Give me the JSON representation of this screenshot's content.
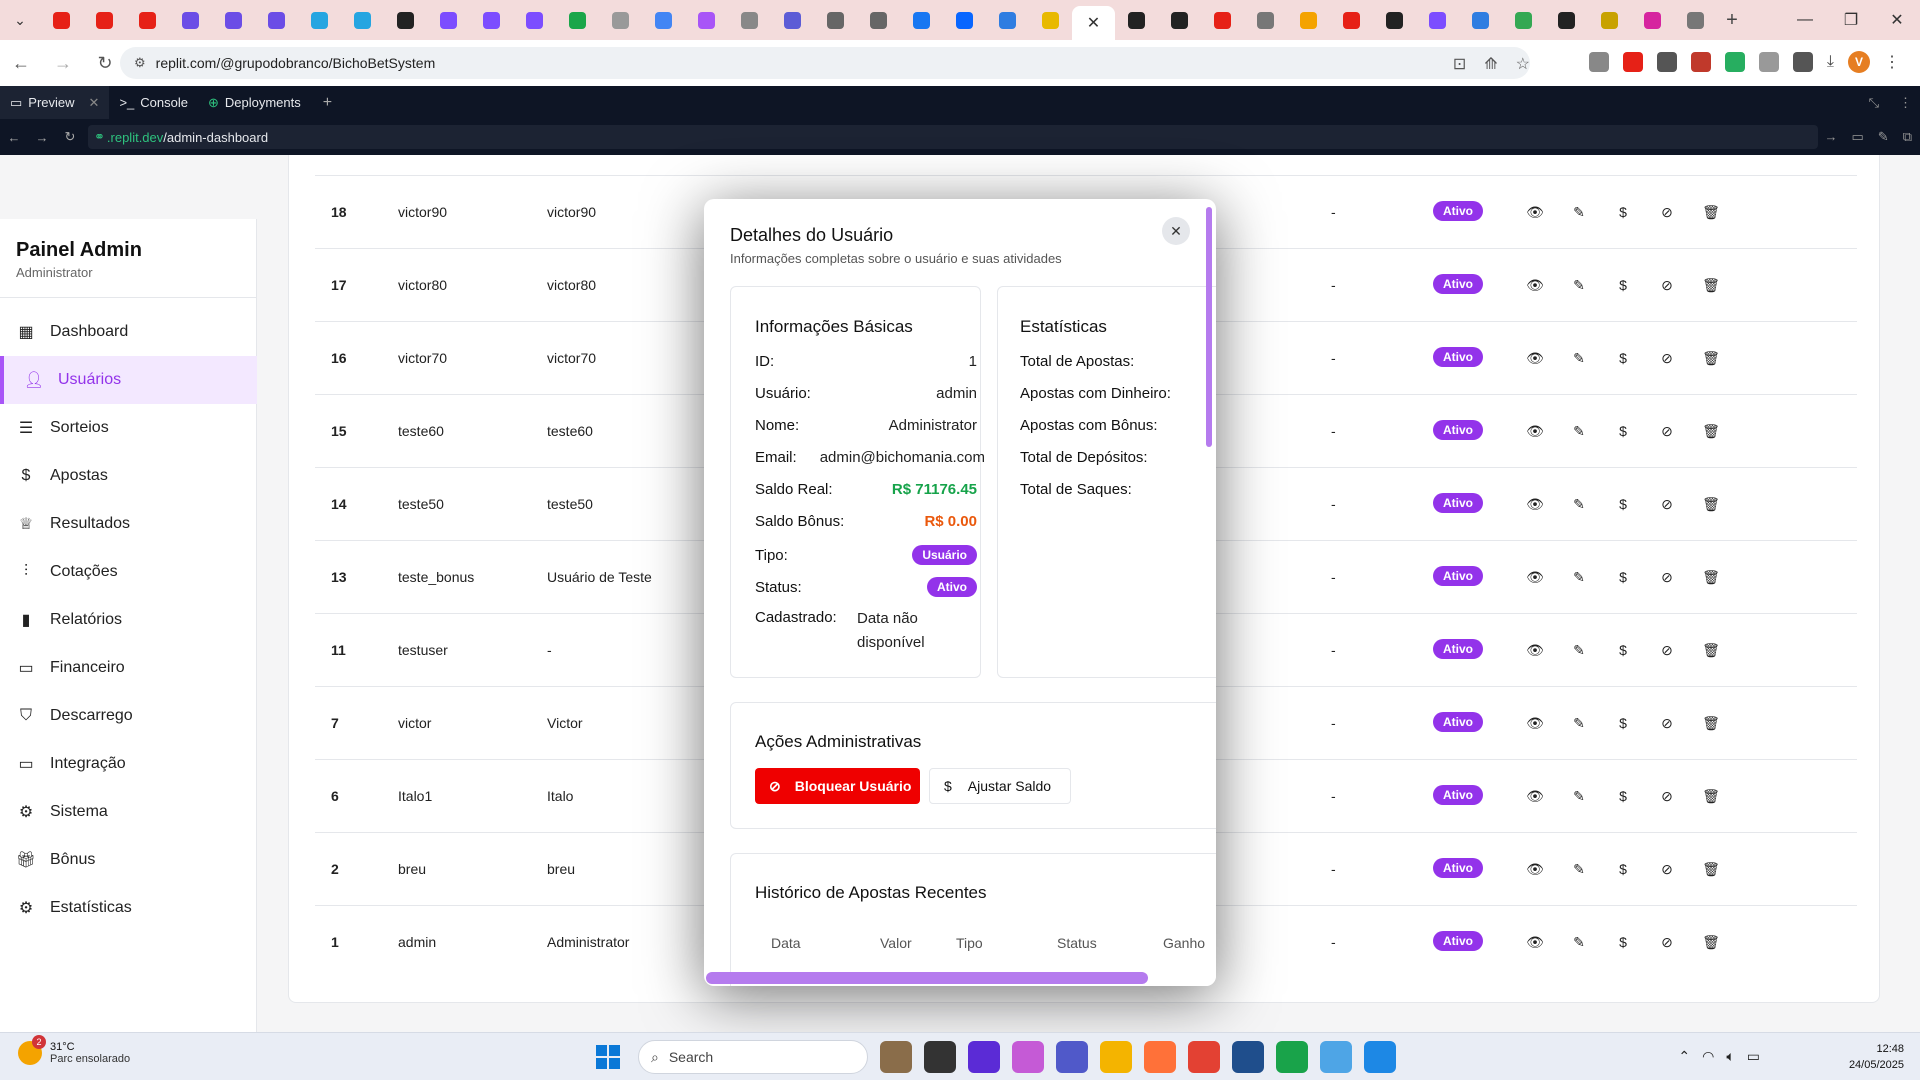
{
  "browser": {
    "tab_favicon_colors": [
      "#e62117",
      "#e62117",
      "#e62117",
      "#6b4de6",
      "#6b4de6",
      "#6b4de6",
      "#25a5e1",
      "#25a5e1",
      "#222222",
      "#7c4dff",
      "#7c4dff",
      "#7c4dff",
      "#1aa64a",
      "#999999",
      "#4285f4",
      "#a855f7",
      "#888888",
      "#5c5cd6",
      "#666666",
      "#666666",
      "#1877f2",
      "#0866ff",
      "#2f7de1",
      "#e8b900"
    ],
    "tab_favicon_colors_after": [
      "#222222",
      "#222222",
      "#e62117",
      "#777777",
      "#f4a300",
      "#e62117",
      "#222222",
      "#7c4dff",
      "#2f7de1",
      "#34a853",
      "#222222",
      "#c8a200",
      "#d6249f",
      "#777777"
    ],
    "active_tab_close": "✕",
    "url": "replit.com/@grupodobranco/BichoBetSystem",
    "ext_colors": [
      "#888888",
      "#e62117",
      "#555555",
      "#c0392b",
      "#27ae60",
      "#999999",
      "#555555"
    ],
    "profile_initial": "V"
  },
  "replit": {
    "tabs": [
      {
        "label": "Preview",
        "icon": "preview-icon"
      },
      {
        "label": "Console",
        "icon": "console-icon"
      },
      {
        "label": "Deployments",
        "icon": "deployments-icon"
      }
    ],
    "url_domain": ".replit.dev",
    "url_path": "/admin-dashboard"
  },
  "sidebar": {
    "title": "Painel Admin",
    "subtitle": "Administrator",
    "items": [
      {
        "label": "Dashboard",
        "icon": "dashboard-icon"
      },
      {
        "label": "Usuários",
        "icon": "users-icon",
        "active": true
      },
      {
        "label": "Sorteios",
        "icon": "list-icon"
      },
      {
        "label": "Apostas",
        "icon": "dollar-icon"
      },
      {
        "label": "Resultados",
        "icon": "trophy-icon"
      },
      {
        "label": "Cotações",
        "icon": "sliders-icon"
      },
      {
        "label": "Relatórios",
        "icon": "bar-chart-icon"
      },
      {
        "label": "Financeiro",
        "icon": "credit-card-icon"
      },
      {
        "label": "Descarrego",
        "icon": "shield-icon"
      },
      {
        "label": "Integração",
        "icon": "credit-card-icon"
      },
      {
        "label": "Sistema",
        "icon": "gear-icon"
      },
      {
        "label": "Bônus",
        "icon": "gift-icon"
      },
      {
        "label": "Estatísticas",
        "icon": "gear-icon"
      }
    ]
  },
  "users_table": {
    "rows": [
      {
        "id": "18",
        "username": "victor90",
        "name": "victor90",
        "col": "-",
        "status": "Ativo"
      },
      {
        "id": "17",
        "username": "victor80",
        "name": "victor80",
        "col": "-",
        "status": "Ativo"
      },
      {
        "id": "16",
        "username": "victor70",
        "name": "victor70",
        "col": "-",
        "status": "Ativo"
      },
      {
        "id": "15",
        "username": "teste60",
        "name": "teste60",
        "col": "-",
        "status": "Ativo"
      },
      {
        "id": "14",
        "username": "teste50",
        "name": "teste50",
        "col": "-",
        "status": "Ativo"
      },
      {
        "id": "13",
        "username": "teste_bonus",
        "name": "Usuário de Teste",
        "col": "-",
        "status": "Ativo"
      },
      {
        "id": "11",
        "username": "testuser",
        "name": "-",
        "col": "-",
        "status": "Ativo"
      },
      {
        "id": "7",
        "username": "victor",
        "name": "Victor",
        "col": "-",
        "status": "Ativo"
      },
      {
        "id": "6",
        "username": "Italo1",
        "name": "Italo",
        "col": "-",
        "status": "Ativo"
      },
      {
        "id": "2",
        "username": "breu",
        "name": "breu",
        "col": "-",
        "status": "Ativo"
      },
      {
        "id": "1",
        "username": "admin",
        "name": "Administrator",
        "col": "-",
        "status": "Ativo"
      }
    ],
    "row_actions": [
      "eye-icon",
      "edit-icon",
      "dollar-icon",
      "block-icon",
      "trash-icon"
    ]
  },
  "modal": {
    "title": "Detalhes do Usuário",
    "subtitle": "Informações completas sobre o usuário e suas atividades",
    "close": "✕",
    "basic": {
      "heading": "Informações Básicas",
      "id_label": "ID:",
      "id_value": "1",
      "user_label": "Usuário:",
      "user_value": "admin",
      "name_label": "Nome:",
      "name_value": "Administrator",
      "email_label": "Email:",
      "email_value": "admin@bichomania.com",
      "real_label": "Saldo Real:",
      "real_value": "R$ 71176.45",
      "bonus_label": "Saldo Bônus:",
      "bonus_value": "R$ 0.00",
      "type_label": "Tipo:",
      "type_value": "Usuário",
      "status_label": "Status:",
      "status_value": "Ativo",
      "registered_label": "Cadastrado:",
      "registered_value": "Data não disponível"
    },
    "stats": {
      "heading": "Estatísticas",
      "items": [
        "Total de Apostas:",
        "Apostas com Dinheiro:",
        "Apostas com Bônus:",
        "Total de Depósitos:",
        "Total de Saques:"
      ]
    },
    "admin_actions": {
      "heading": "Ações Administrativas",
      "block_label": "Bloquear Usuário",
      "adjust_label": "Ajustar Saldo"
    },
    "history": {
      "heading": "Histórico de Apostas Recentes",
      "columns": [
        "Data",
        "Valor",
        "Tipo",
        "Status",
        "Ganho"
      ]
    }
  },
  "taskbar": {
    "temperature": "31°C",
    "weather": "Parc ensolarado",
    "weather_badge": "2",
    "search_placeholder": "Search",
    "time": "12:48",
    "date": "24/05/2025",
    "app_colors": [
      "#8a6d4a",
      "#333333",
      "#5b2bd6",
      "#c55ad6",
      "#5059c9",
      "#f4b400",
      "#ff7139",
      "#e34133",
      "#1f4e8c",
      "#19a34a",
      "#4ea5e6",
      "#1d88e5"
    ]
  }
}
